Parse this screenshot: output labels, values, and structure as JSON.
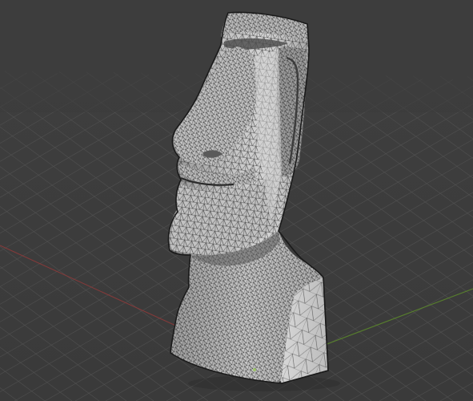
{
  "viewport": {
    "background_color": "#3d3d3d",
    "grid_color": "#545454",
    "axis_x_color": "#9b3b3b",
    "axis_y_color": "#5e8a2c",
    "grid_visible": true
  },
  "model": {
    "icon": "moai-head-mesh",
    "display_mode": "wireframe-on-shaded",
    "surface_color": "#c9c9c9",
    "wire_color": "#222222"
  }
}
